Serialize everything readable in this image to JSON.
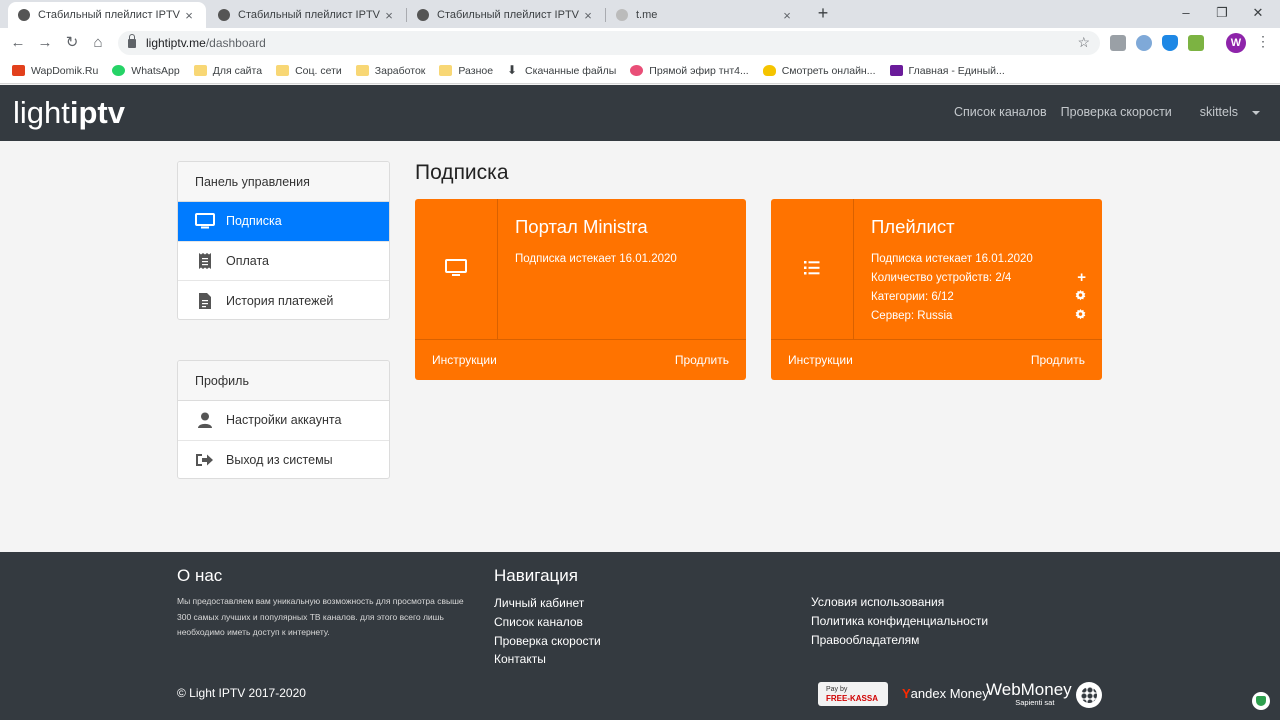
{
  "browser": {
    "tabs": [
      {
        "title": "Стабильный плейлист IPTV",
        "active": true
      },
      {
        "title": "Стабильный плейлист IPTV",
        "active": false
      },
      {
        "title": "Стабильный плейлист IPTV",
        "active": false
      },
      {
        "title": "t.me",
        "active": false
      }
    ],
    "new_tab": "+",
    "url_host": "lightiptv.me",
    "url_path": "/dashboard",
    "profile_initial": "W",
    "bookmarks": [
      {
        "label": "WapDomik.Ru",
        "icon": "wapdomik-icon"
      },
      {
        "label": "WhatsApp",
        "icon": "whatsapp-icon"
      },
      {
        "label": "Для сайта",
        "icon": "folder-icon"
      },
      {
        "label": "Соц. сети",
        "icon": "folder-icon"
      },
      {
        "label": "Заработок",
        "icon": "folder-icon"
      },
      {
        "label": "Разное",
        "icon": "folder-icon"
      },
      {
        "label": "Скачанные файлы",
        "icon": "download-icon"
      },
      {
        "label": "Прямой эфир тнт4...",
        "icon": "tnt-icon"
      },
      {
        "label": "Смотреть онлайн...",
        "icon": "heart-icon"
      },
      {
        "label": "Главная - Единый...",
        "icon": "bookmark-icon"
      }
    ]
  },
  "header": {
    "logo_light": "light",
    "logo_iptv": "iptv",
    "nav": {
      "channels": "Список каналов",
      "speed": "Проверка скорости",
      "user": "skittels"
    }
  },
  "sidebar": {
    "control_panel": {
      "title": "Панель управления",
      "items": [
        {
          "label": "Подписка",
          "icon": "monitor-icon"
        },
        {
          "label": "Оплата",
          "icon": "receipt-icon"
        },
        {
          "label": "История платежей",
          "icon": "document-icon"
        }
      ]
    },
    "profile": {
      "title": "Профиль",
      "items": [
        {
          "label": "Настройки аккаунта",
          "icon": "user-icon"
        },
        {
          "label": "Выход из системы",
          "icon": "sign-out-icon"
        }
      ]
    }
  },
  "main": {
    "title": "Подписка",
    "cards": [
      {
        "title": "Портал Ministra",
        "expires": "Подписка истекает 16.01.2020",
        "instructions": "Инструкции",
        "renew": "Продлить"
      },
      {
        "title": "Плейлист",
        "expires": "Подписка истекает 16.01.2020",
        "devices": "Количество устройств: 2/4",
        "categories": "Категории: 6/12",
        "server": "Сервер: Russia",
        "instructions": "Инструкции",
        "renew": "Продлить"
      }
    ]
  },
  "footer": {
    "about_title": "О нас",
    "about_text": "Мы предоставляем вам уникальную возможность для просмотра свыше 300 самых лучших и популярных ТВ каналов. для этого всего лишь необходимо иметь доступ к интернету.",
    "nav_title": "Навигация",
    "nav_links": [
      "Личный кабинет",
      "Список каналов",
      "Проверка скорости",
      "Контакты"
    ],
    "legal_links": [
      "Условия использования",
      "Политика конфиденциальности",
      "Правообладателям"
    ],
    "copyright": "© Light IPTV 2017-2020",
    "freekassa_top": "Pay by",
    "freekassa_brand": "FREE-KASSA",
    "yandex_y": "Y",
    "yandex_rest": "andex Money",
    "webmoney": "WebMoney",
    "webmoney_sub": "Sapienti sat"
  },
  "colors": {
    "accent_orange": "#ff7300",
    "active_blue": "#007bff",
    "header_dark": "#343a40"
  }
}
